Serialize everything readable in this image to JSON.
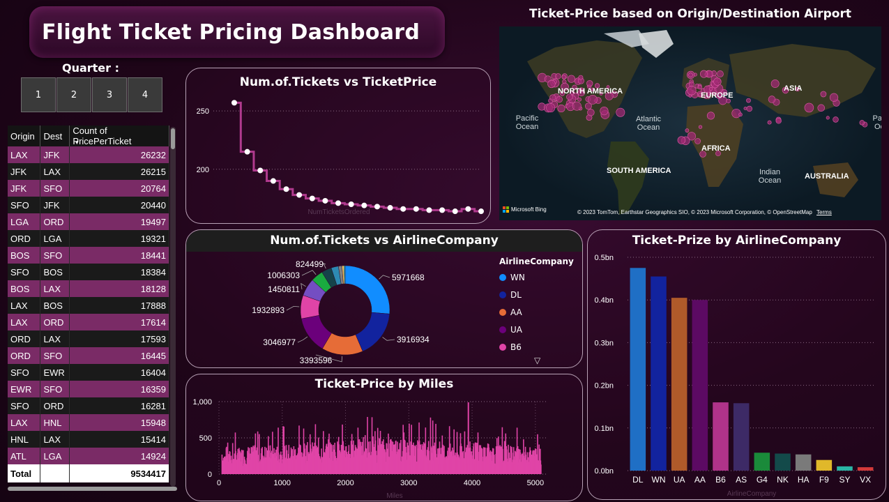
{
  "header": {
    "title": "Flight Ticket Pricing Dashboard"
  },
  "quarter": {
    "label": "Quarter :",
    "options": [
      "1",
      "2",
      "3",
      "4"
    ]
  },
  "routes_table": {
    "columns": [
      "Origin",
      "Dest",
      "Count of PricePerTicket"
    ],
    "rows": [
      [
        "LAX",
        "JFK",
        "26232"
      ],
      [
        "JFK",
        "LAX",
        "26215"
      ],
      [
        "JFK",
        "SFO",
        "20764"
      ],
      [
        "SFO",
        "JFK",
        "20440"
      ],
      [
        "LGA",
        "ORD",
        "19497"
      ],
      [
        "ORD",
        "LGA",
        "19321"
      ],
      [
        "BOS",
        "SFO",
        "18441"
      ],
      [
        "SFO",
        "BOS",
        "18384"
      ],
      [
        "BOS",
        "LAX",
        "18128"
      ],
      [
        "LAX",
        "BOS",
        "17888"
      ],
      [
        "LAX",
        "ORD",
        "17614"
      ],
      [
        "ORD",
        "LAX",
        "17593"
      ],
      [
        "ORD",
        "SFO",
        "16445"
      ],
      [
        "SFO",
        "EWR",
        "16404"
      ],
      [
        "EWR",
        "SFO",
        "16359"
      ],
      [
        "SFO",
        "ORD",
        "16281"
      ],
      [
        "LAX",
        "HNL",
        "15948"
      ],
      [
        "HNL",
        "LAX",
        "15414"
      ],
      [
        "ATL",
        "LGA",
        "14924"
      ]
    ],
    "total_label": "Total",
    "total_value": "9534417"
  },
  "map_panel": {
    "title": "Ticket-Price based on Origin/Destination Airport",
    "continents": [
      "NORTH AMERICA",
      "EUROPE",
      "ASIA",
      "AFRICA",
      "SOUTH AMERICA",
      "AUSTRALIA"
    ],
    "oceans": [
      "Pacific Ocean",
      "Atlantic Ocean",
      "Indian Ocean",
      "Pac Oc"
    ],
    "brand": "Microsoft Bing",
    "copyright": "© 2023 TomTom, Earthstar Geographics SIO, © 2023 Microsoft Corporation, © OpenStreetMap",
    "terms": "Terms"
  },
  "chart_data": [
    {
      "type": "line",
      "title": "Num.of.Tickets vs TicketPrice",
      "xlabel": "NumTicketsOrdered",
      "ylabel": "",
      "ylim": [
        170,
        262
      ],
      "y_ticks": [
        200,
        250
      ],
      "x": [
        1,
        2,
        3,
        4,
        5,
        6,
        7,
        8,
        9,
        10,
        11,
        12,
        13,
        14,
        15,
        16,
        17,
        18,
        19,
        20
      ],
      "values": [
        257,
        215,
        199,
        190,
        183,
        178,
        175,
        173,
        171,
        170,
        169,
        168,
        167,
        166,
        166,
        165,
        165,
        164,
        166,
        164
      ],
      "color": "#b03a8e"
    },
    {
      "type": "pie",
      "title": "Num.of.Tickets vs AirlineCompany",
      "legend_title": "AirlineCompany",
      "legend": [
        "WN",
        "DL",
        "AA",
        "UA",
        "B6"
      ],
      "slices": [
        {
          "name": "WN",
          "value": 5971668,
          "color": "#118dff"
        },
        {
          "name": "DL",
          "value": 3916934,
          "color": "#12239e"
        },
        {
          "name": "AA",
          "value": 3393596,
          "color": "#e66c37"
        },
        {
          "name": "UA",
          "value": 3046977,
          "color": "#6b007b"
        },
        {
          "name": "B6",
          "value": 1932893,
          "color": "#e044a7"
        },
        {
          "name": "AS",
          "value": 1450811,
          "color": "#744ec2"
        },
        {
          "name": "G4",
          "value": 1006303,
          "color": "#1aab40"
        },
        {
          "name": "NK",
          "value": 824499,
          "color": "#15434a"
        },
        {
          "name": "HA",
          "value": 600000,
          "color": "#2d8ab3"
        },
        {
          "name": "F9",
          "value": 300000,
          "color": "#808080"
        },
        {
          "name": "SY",
          "value": 150000,
          "color": "#ffd166"
        },
        {
          "name": "VX",
          "value": 100000,
          "color": "#4ecdc4"
        }
      ],
      "shown_labels": [
        "5971668",
        "3916934",
        "3393596",
        "3046977",
        "1932893",
        "1450811",
        "1006303",
        "824499"
      ]
    },
    {
      "type": "bar",
      "title": "Ticket-Price by Miles",
      "xlabel": "Miles",
      "ylabel": "",
      "xlim": [
        0,
        5200
      ],
      "ylim": [
        0,
        1000
      ],
      "x_ticks": [
        0,
        1000,
        2000,
        3000,
        4000,
        5000
      ],
      "y_ticks": [
        0,
        500,
        1000
      ],
      "y_tick_labels": [
        "0",
        "500",
        "1,000"
      ],
      "color": "#e044a7",
      "profile": [
        {
          "x": 50,
          "y": 250
        },
        {
          "x": 500,
          "y": 320
        },
        {
          "x": 1000,
          "y": 330
        },
        {
          "x": 1500,
          "y": 360
        },
        {
          "x": 2000,
          "y": 380
        },
        {
          "x": 2500,
          "y": 400
        },
        {
          "x": 3000,
          "y": 380
        },
        {
          "x": 3500,
          "y": 370
        },
        {
          "x": 3930,
          "y": 990
        },
        {
          "x": 4000,
          "y": 360
        },
        {
          "x": 4500,
          "y": 330
        },
        {
          "x": 5000,
          "y": 300
        }
      ]
    },
    {
      "type": "bar",
      "title": "Ticket-Prize by AirlineCompany",
      "xlabel": "AirlineCompany",
      "ylabel": "",
      "ylim": [
        0,
        0.5
      ],
      "y_ticks": [
        0,
        0.1,
        0.2,
        0.3,
        0.4,
        0.5
      ],
      "y_tick_labels": [
        "0.0bn",
        "0.1bn",
        "0.2bn",
        "0.3bn",
        "0.4bn",
        "0.5bn"
      ],
      "categories": [
        "DL",
        "WN",
        "UA",
        "AA",
        "B6",
        "AS",
        "G4",
        "NK",
        "HA",
        "F9",
        "SY",
        "VX"
      ],
      "values": [
        0.475,
        0.455,
        0.405,
        0.4,
        0.16,
        0.158,
        0.042,
        0.04,
        0.038,
        0.025,
        0.01,
        0.008
      ],
      "colors": [
        "#1f6fc5",
        "#12239e",
        "#b05a2a",
        "#5c0a63",
        "#b0338a",
        "#3d2a66",
        "#1a8a3a",
        "#134a4a",
        "#7a7a7a",
        "#e0b82a",
        "#2ab5a5",
        "#d43a3a"
      ]
    }
  ]
}
